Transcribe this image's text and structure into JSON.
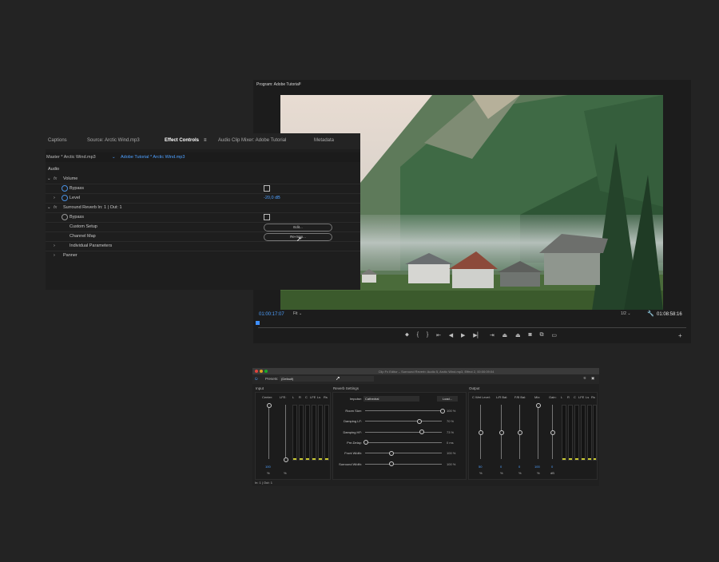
{
  "program": {
    "title": "Program: Adobe Tutorial",
    "menu_icon": "hamburger-icon",
    "timecode_current": "01:00:17:07",
    "fit": "Fit",
    "quality": "1/2",
    "timecode_duration": "01:08:58:16",
    "accent": "#4ea0ff"
  },
  "effect_controls": {
    "tabs": [
      "Captions",
      "Source: Arctic Wind.mp3",
      "Effect Controls",
      "Audio Clip Mixer: Adobe Tutorial",
      "Metadata"
    ],
    "active_tab": "Effect Controls",
    "master_clip": "Master * Arctic Wind.mp3",
    "sequence_clip": "Adobe Tutorial * Arctic Wind.mp3",
    "section": "Audio",
    "volume_label": "Volume",
    "bypass_label": "Bypass",
    "level_label": "Level",
    "level_value": "-20,0 dB",
    "reverb_label": "Surround Reverb  In: 1 | Out: 1",
    "reverb_bypass_label": "Bypass",
    "custom_setup_label": "Custom Setup",
    "edit_button": "Edit...",
    "channel_map_label": "Channel Map",
    "remap_button": "Re-map...",
    "individual_params_label": "Individual Parameters",
    "panner_label": "Panner"
  },
  "clip_fx": {
    "title": "Clip Fx Editor – Surround Reverb: Audio 5, Arctic Wind.mp3, Effect 2, 00:00:09:04",
    "presets_label": "Presets:",
    "preset_value": "(Default)",
    "input_section": "Input",
    "center_label": "Center:",
    "lfe_label": "LFE:",
    "input_channels": [
      "L",
      "R",
      "C",
      "LFE",
      "Ls",
      "Rs"
    ],
    "center_value": "100",
    "center_unit": "%",
    "lfe_unit": "%",
    "reverb_section": "Reverb Settings",
    "impulse_label": "Impulse:",
    "impulse_value": "Cathedral",
    "load_button": "Load...",
    "sliders": [
      {
        "label": "Room Size:",
        "value": "100 %",
        "level": 1.0
      },
      {
        "label": "Damping LF:",
        "value": "70 %",
        "level": 0.7
      },
      {
        "label": "Damping HF:",
        "value": "73 %",
        "level": 0.73
      },
      {
        "label": "Pre-Delay:",
        "value": "0 ms",
        "level": 0.0
      },
      {
        "label": "Front Width:",
        "value": "100 %",
        "level": 0.33
      },
      {
        "label": "Surround Width:",
        "value": "100 %",
        "level": 0.33
      }
    ],
    "output_section": "Output",
    "out_labels": [
      "C Wet Level:",
      "L/R Bal:",
      "F/B Bal:",
      "Mix:",
      "Gain:"
    ],
    "out_values": [
      "50",
      "0",
      "0",
      "100",
      "0"
    ],
    "out_units": [
      "%",
      "%",
      "%",
      "%",
      "dB"
    ],
    "output_channels": [
      "L",
      "R",
      "C",
      "LFE",
      "Ls",
      "Rs"
    ],
    "footer": "In: 1 | Out: 1"
  }
}
